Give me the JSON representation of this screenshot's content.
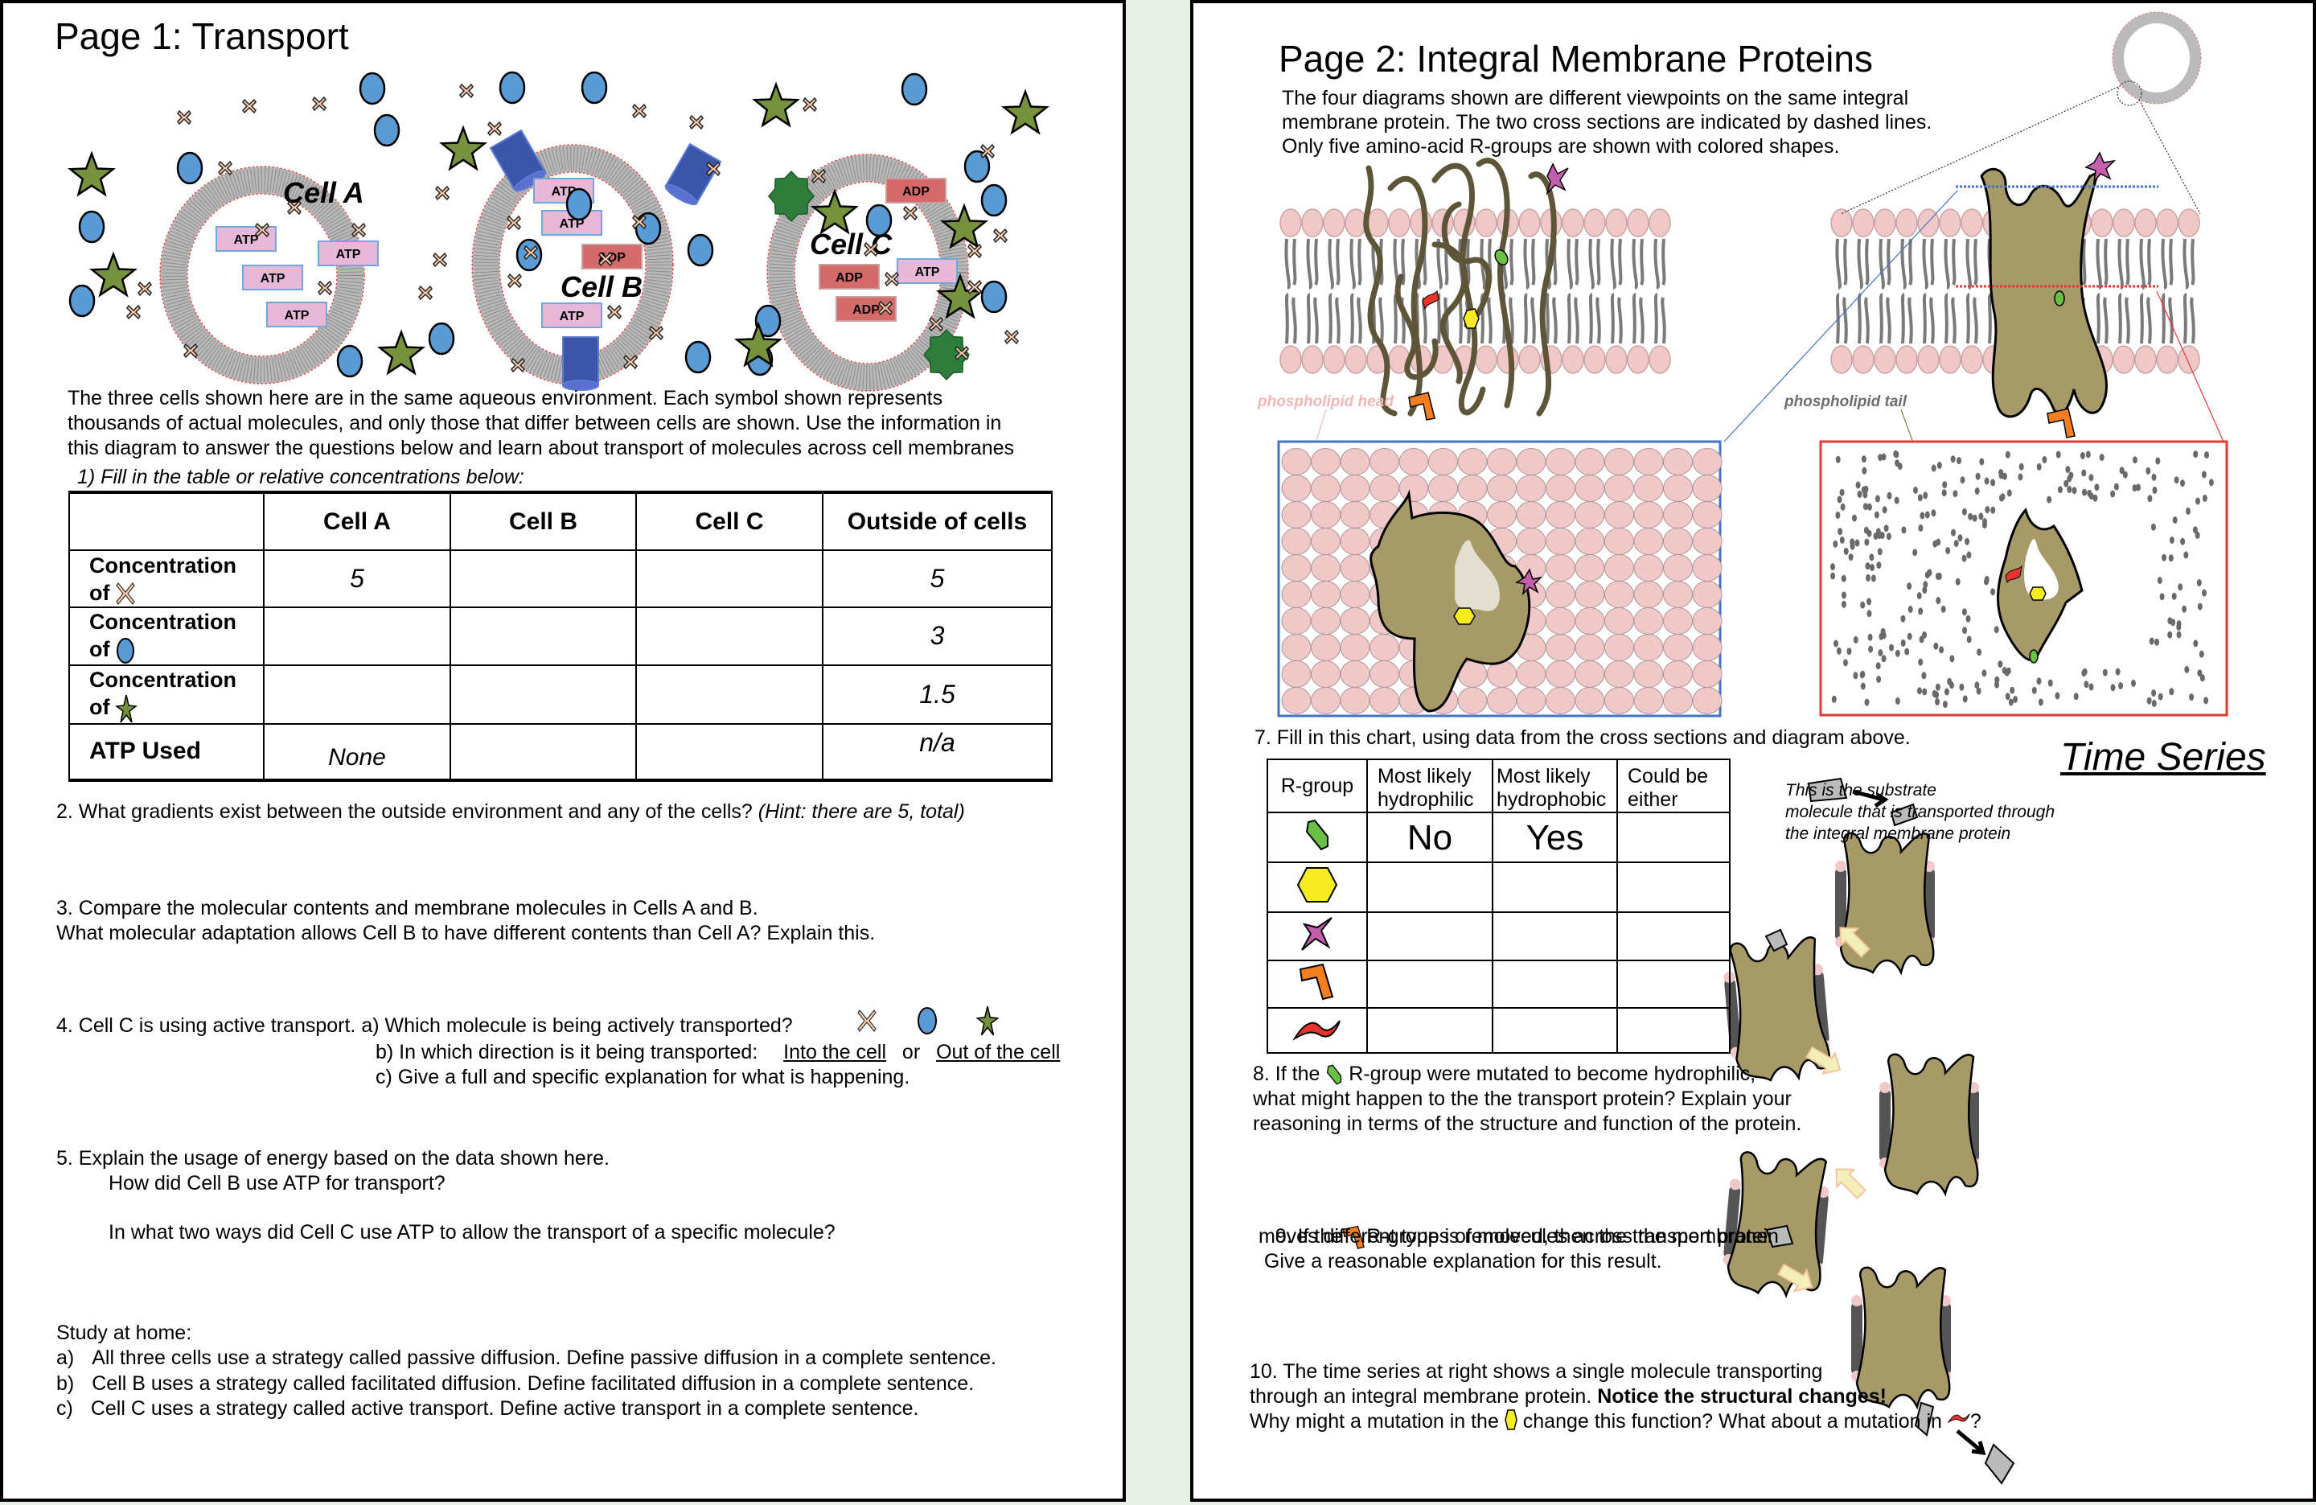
{
  "page1": {
    "title": "Page 1: Transport",
    "diagram": {
      "cell_labels": [
        "Cell A",
        "Cell B",
        "Cell C"
      ],
      "cell_a_contents": [
        "ATP",
        "ATP",
        "ATP",
        "ATP"
      ],
      "cell_b_contents": [
        "ATP",
        "ATP",
        "ADP",
        "ATP"
      ],
      "cell_c_contents": [
        "ADP",
        "ADP",
        "ATP",
        "ADP"
      ],
      "legend_molecules": [
        "x-molecule",
        "circle-molecule",
        "star-molecule"
      ]
    },
    "intro": [
      "The three cells shown here are in the same aqueous environment. Each symbol shown represents",
      "thousands of actual molecules, and only those that differ between cells are shown. Use the information in",
      "this diagram to answer the questions below and learn about transport of molecules across cell membranes"
    ],
    "q1_label": "1) Fill in the table or relative concentrations below:",
    "table": {
      "headers": [
        "",
        "Cell A",
        "Cell B",
        "Cell C",
        "Outside of cells"
      ],
      "rows": [
        {
          "label": "Concentration",
          "label2": "of",
          "icon": "x-molecule-icon",
          "values": [
            "5",
            "",
            "",
            "5"
          ]
        },
        {
          "label": "Concentration",
          "label2": "of",
          "icon": "circle-molecule-icon",
          "values": [
            "",
            "",
            "",
            "3"
          ]
        },
        {
          "label": "Concentration",
          "label2": "of",
          "icon": "star-molecule-icon",
          "values": [
            "",
            "",
            "",
            "1.5"
          ]
        },
        {
          "label": "ATP Used",
          "label2": "",
          "icon": "",
          "values": [
            "None",
            "",
            "",
            "n/a"
          ]
        }
      ]
    },
    "q2": {
      "text": "2. What gradients exist between the outside environment and any of the cells? ",
      "hint": "(Hint: there are 5, total)"
    },
    "q3": [
      "3. Compare the molecular contents and membrane molecules in Cells A and B.",
      "What molecular adaptation allows Cell B to have different contents than Cell A? Explain this."
    ],
    "q4": {
      "a": "4. Cell C is using active transport. a) Which molecule is being actively transported?",
      "b": "b) In which direction is it being transported:",
      "option_in": "Into the cell",
      "or": "or",
      "option_out": "Out of the cell",
      "c": "c) Give a full and specific explanation for what is happening."
    },
    "q5": [
      "5. Explain the usage of energy based on the data shown here.",
      "How did Cell B use ATP for transport?",
      "In what two ways did Cell C use ATP to allow the transport of a specific molecule?"
    ],
    "study": {
      "heading": "Study at home:",
      "items": [
        {
          "marker": "a)",
          "text": "All three cells use a strategy called passive diffusion. Define passive diffusion in a complete sentence."
        },
        {
          "marker": "b)",
          "text": "Cell B uses a strategy called facilitated diffusion. Define facilitated diffusion in a complete sentence."
        },
        {
          "marker": "c)",
          "text": "Cell C uses a strategy called active transport. Define active transport in a complete sentence."
        }
      ]
    }
  },
  "page2": {
    "title": "Page 2: Integral Membrane Proteins",
    "intro": [
      "The four diagrams shown are different viewpoints on the same integral",
      "membrane protein. The two cross sections are indicated by dashed lines.",
      "Only five amino-acid R-groups are shown with colored shapes."
    ],
    "labels": {
      "head": "phospholipid head",
      "tail": "phospholipid tail"
    },
    "q7": "7. Fill in this chart, using data from the cross sections and diagram above.",
    "rgroup_table": {
      "headers": [
        "R-group",
        "Most likely\nhydrophilic",
        "Most likely\nhydrophobic",
        "Could be\neither"
      ],
      "header_lines": [
        [
          "R-group"
        ],
        [
          "Most likely",
          "hydrophilic"
        ],
        [
          "Most likely",
          "hydrophobic"
        ],
        [
          "Could be",
          "either"
        ]
      ],
      "rows": [
        {
          "icon": "green-octagon-rgroup-icon",
          "values": [
            "No",
            "Yes",
            ""
          ]
        },
        {
          "icon": "yellow-hexagon-rgroup-icon",
          "values": [
            "",
            "",
            ""
          ]
        },
        {
          "icon": "purple-star-rgroup-icon",
          "values": [
            "",
            "",
            ""
          ]
        },
        {
          "icon": "orange-bracket-rgroup-icon",
          "values": [
            "",
            "",
            ""
          ]
        },
        {
          "icon": "red-wave-rgroup-icon",
          "values": [
            "",
            "",
            ""
          ]
        }
      ]
    },
    "time_series": {
      "title": "Time Series",
      "caption": [
        "This is the substrate",
        "molecule that is transported through",
        "the integral membrane protein"
      ]
    },
    "q8": {
      "prefix": "8. If the ",
      "suffix": " R-group were mutated to become hydrophilic,",
      "lines": [
        "what might happen to the the transport protein? Explain your",
        "reasoning in terms of the structure and function of the protein."
      ]
    },
    "q9": {
      "prefix": "9. If the",
      "suffix": "R-group is removed, then the transport protein",
      "lines": [
        " moves different types of molecules across the membrane.",
        "  Give a reasonable explanation for this result."
      ]
    },
    "q10": {
      "line1": "10. The time series at right shows a single molecule transporting",
      "line2_plain": "through an integral membrane protein. ",
      "line2_bold": "Notice the structural changes!",
      "line3_a": "Why might a mutation in the ",
      "line3_b": " change this function? What about a mutation in ",
      "line3_c": "?"
    }
  },
  "colors": {
    "page_gap": "#e6f0e4",
    "molecule_circle": "#5b9bd5",
    "molecule_star": "#76923c",
    "molecule_x": "#f8cbad",
    "atp_box": "#e8b8d8",
    "adp_box": "#d46a6a",
    "channel": "#3b55a8",
    "pump": "#2e7d3a",
    "protein": "#a59a68",
    "head": "#f0c8c8",
    "tail": "#7a7a7a",
    "cross_blue": "#4472c4",
    "cross_red": "#e53935"
  }
}
